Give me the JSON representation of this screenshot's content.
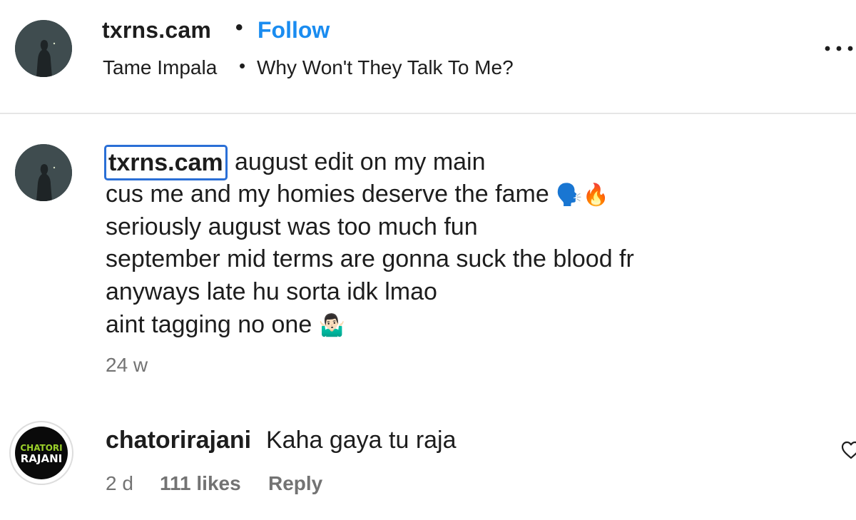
{
  "header": {
    "username": "txrns.cam",
    "separator": "•",
    "follow_label": "Follow",
    "artist": "Tame Impala",
    "song": "Why Won't They Talk To Me?",
    "more_icon": "more-options-icon"
  },
  "caption": {
    "username": "txrns.cam",
    "lines": [
      "august edit on my main",
      "cus me and my homies deserve the fame",
      "seriously august was too much fun",
      "september mid terms are gonna suck the blood fr",
      "anyways late hu sorta idk lmao",
      "aint tagging no one"
    ],
    "line2_emoji": "🗣️🔥",
    "line6_emoji": "🤷🏻‍♂️",
    "time": "24 w"
  },
  "reply": {
    "username": "chatorirajani",
    "text": "Kaha gaya tu raja",
    "time": "2 d",
    "likes": "111 likes",
    "reply_label": "Reply",
    "avatar_logo_text": "CHATORI RAJANI"
  },
  "colors": {
    "accent_blue": "#1a8cf0",
    "focus_outline": "#2a6fd6",
    "muted_text": "#737373",
    "logo_green": "#9bd12a"
  }
}
